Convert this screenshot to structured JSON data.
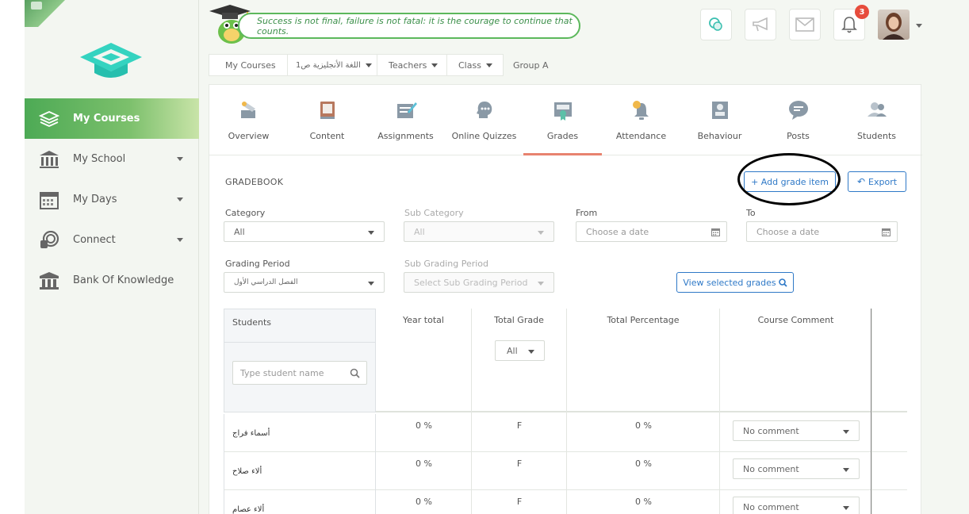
{
  "header": {
    "quote": "Success is not final, failure is not fatal: it is the courage to continue that counts.",
    "notification_count": "3"
  },
  "sidebar": {
    "items": [
      {
        "label": "My Courses",
        "icon": "layers-icon",
        "active": true
      },
      {
        "label": "My School",
        "icon": "school-building-icon"
      },
      {
        "label": "My Days",
        "icon": "calendar-icon"
      },
      {
        "label": "Connect",
        "icon": "chat-bubbles-icon"
      },
      {
        "label": "Bank Of Knowledge",
        "icon": "bank-icon"
      }
    ]
  },
  "breadcrumb": {
    "my_courses": "My Courses",
    "course": "اللغة الأنجليزية ص1",
    "teachers": "Teachers",
    "class": "Class",
    "group": "Group A"
  },
  "tabs": [
    {
      "label": "Overview"
    },
    {
      "label": "Content"
    },
    {
      "label": "Assignments"
    },
    {
      "label": "Online Quizzes"
    },
    {
      "label": "Grades",
      "active": true
    },
    {
      "label": "Attendance"
    },
    {
      "label": "Behaviour"
    },
    {
      "label": "Posts"
    },
    {
      "label": "Students"
    }
  ],
  "gradebook": {
    "title": "GRADEBOOK",
    "add_button": "+ Add grade item",
    "export_button": "Export",
    "view_button": "View selected grades",
    "filters": {
      "category_label": "Category",
      "category_value": "All",
      "subcategory_label": "Sub Category",
      "subcategory_value": "All",
      "from_label": "From",
      "from_placeholder": "Choose a date",
      "to_label": "To",
      "to_placeholder": "Choose a date",
      "grading_period_label": "Grading Period",
      "grading_period_value": "الفصل الدراسي الأول",
      "sub_grading_period_label": "Sub Grading Period",
      "sub_grading_period_value": "Select Sub Grading Period"
    }
  },
  "table": {
    "students_header": "Students",
    "search_placeholder": "Type student name",
    "year_total_header": "Year total",
    "total_grade_header": "Total Grade",
    "total_grade_filter": "All",
    "total_percentage_header": "Total Percentage",
    "course_comment_header": "Course Comment",
    "rows": [
      {
        "name": "أسماء فراج",
        "year_total": "0 %",
        "grade": "F",
        "percentage": "0 %",
        "comment": "No comment"
      },
      {
        "name": "ألاء صلاح",
        "year_total": "0 %",
        "grade": "F",
        "percentage": "0 %",
        "comment": "No comment"
      },
      {
        "name": "ألاء عصام",
        "year_total": "0 %",
        "grade": "F",
        "percentage": "0 %",
        "comment": "No comment"
      }
    ]
  }
}
